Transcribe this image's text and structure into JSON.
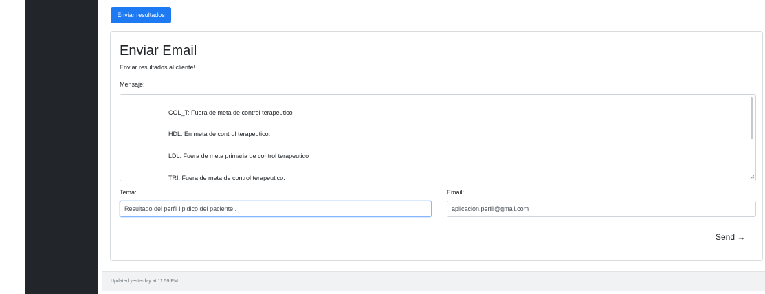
{
  "toolbar": {
    "send_results_label": "Enviar resultados"
  },
  "card": {
    "title": "Enviar Email",
    "subtitle": "Enviar resultados al cliente!",
    "message_label": "Mensaje:",
    "message_lines": [
      "COL_T: Fuera de meta de control terapeutico",
      "HDL: En meta de control terapeutico.",
      "LDL: Fuera de meta primaria de control terapeutico",
      "TRI: Fuera de meta de control terapeutico."
    ],
    "topic_label": "Tema:",
    "topic_value": "Resultado del perfil lipidico del paciente .",
    "email_label": "Email:",
    "email_value": "aplicacion.perfil@gmail.com",
    "send_label": "Send →"
  },
  "footer": {
    "updated_text": "Updated yesterday at 11:59 PM"
  },
  "colors": {
    "sidebar": "#22252a",
    "primary_button": "#1d7af2",
    "footer_bg": "#f1f2f3"
  }
}
